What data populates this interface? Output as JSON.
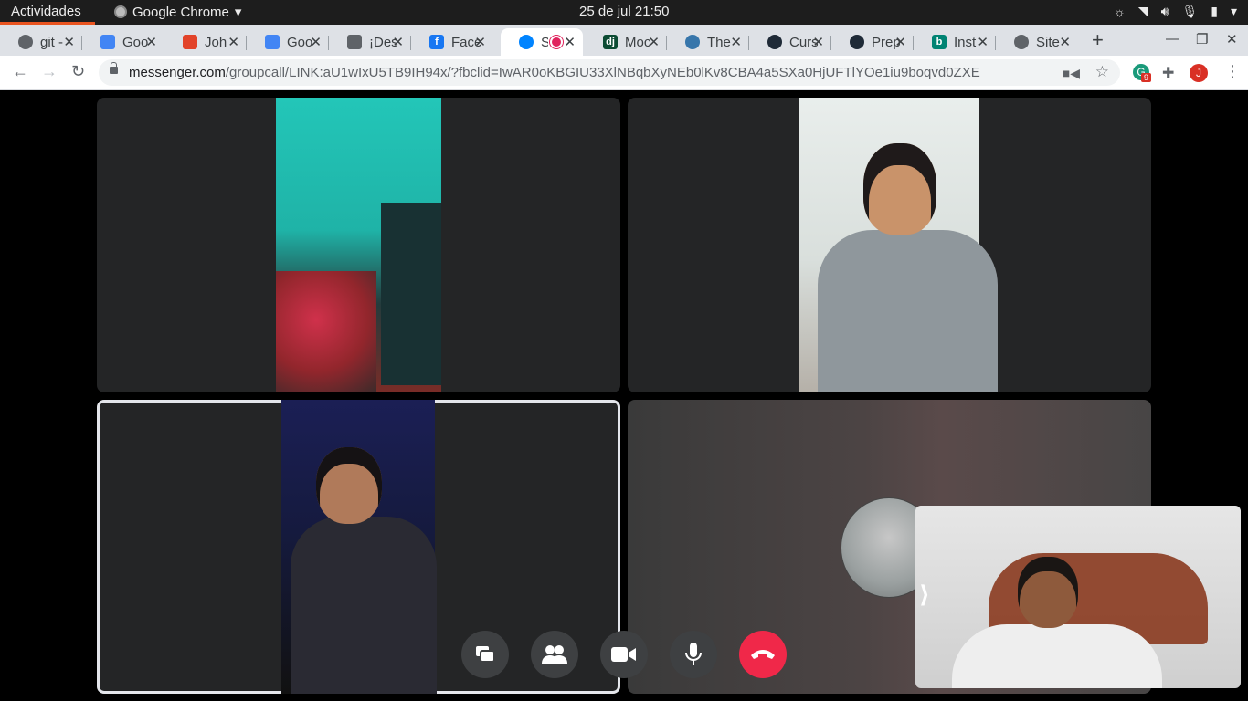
{
  "topbar": {
    "activities": "Actividades",
    "app_name": "Google Chrome",
    "clock": "25 de jul  21:50"
  },
  "tabs": [
    {
      "title": "git -",
      "favicon": "globe-icon",
      "color": "#5f6368"
    },
    {
      "title": "Goo",
      "favicon": "google-docs-icon",
      "color": "#4285f4"
    },
    {
      "title": "Joh",
      "favicon": "gitlab-icon",
      "color": "#e24329"
    },
    {
      "title": "Goo",
      "favicon": "google-docs-icon",
      "color": "#4285f4"
    },
    {
      "title": "¡Des",
      "favicon": "book-icon",
      "color": "#5f6368"
    },
    {
      "title": "Face",
      "favicon": "facebook-icon",
      "color": "#1877f2"
    },
    {
      "title": "S",
      "favicon": "messenger-icon",
      "color": "#0084ff",
      "active": true,
      "recording": true
    },
    {
      "title": "Moc",
      "favicon": "django-icon",
      "color": "#0c4b33"
    },
    {
      "title": "The",
      "favicon": "python-icon",
      "color": "#3776ab"
    },
    {
      "title": "Curs",
      "favicon": "platzi-icon",
      "color": "#1f2a37"
    },
    {
      "title": "Prep",
      "favicon": "platzi-icon",
      "color": "#1f2a37"
    },
    {
      "title": "Inst",
      "favicon": "bing-icon",
      "color": "#008373"
    },
    {
      "title": "Site",
      "favicon": "globe-icon",
      "color": "#5f6368"
    }
  ],
  "toolbar": {
    "url_host": "messenger.com",
    "url_path": "/groupcall/LINK:aU1wIxU5TB9IH94x/?fbclid=IwAR0oKBGIU33XlNBqbXyNEb0lKv8CBA4a5SXa0HjUFTlYOe1iu9boqvd0ZXE",
    "extension_badge": "9",
    "profile_initial": "J"
  },
  "call": {
    "end_button_color": "#f02849",
    "controls": [
      "screen-share-icon",
      "participants-icon",
      "camera-icon",
      "microphone-icon",
      "end-call-icon"
    ]
  }
}
